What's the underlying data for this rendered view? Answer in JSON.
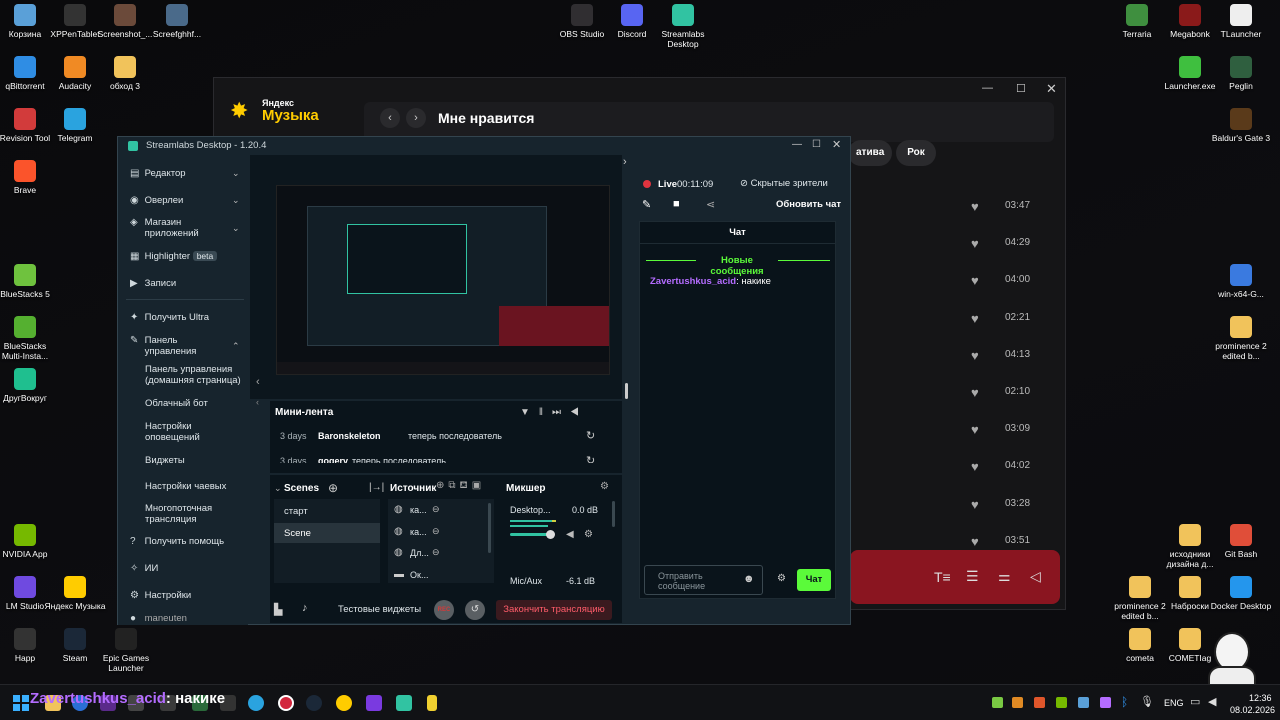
{
  "desktop": {
    "left_icons": [
      {
        "label": "Корзина",
        "icon": "recycle-bin-icon",
        "color": "#5aa0d8"
      },
      {
        "label": "XPPenTablet",
        "icon": "xppen-icon",
        "color": "#333333"
      },
      {
        "label": "Screenshot_...",
        "icon": "image-file-icon",
        "color": "#6b4a3a"
      },
      {
        "label": "Screefghhf...",
        "icon": "image-file-icon",
        "color": "#4a6a8a"
      },
      {
        "label": "qBittorrent",
        "icon": "qbittorrent-icon",
        "color": "#2f8de4"
      },
      {
        "label": "Audacity",
        "icon": "audacity-icon",
        "color": "#f08a24"
      },
      {
        "label": "обход 3",
        "icon": "folder-icon",
        "color": "#f1c35b"
      },
      {
        "label": "Revision Tool",
        "icon": "revision-tool-icon",
        "color": "#d23b3b"
      },
      {
        "label": "Telegram",
        "icon": "telegram-icon",
        "color": "#2aa3df"
      },
      {
        "label": "Brave",
        "icon": "brave-icon",
        "color": "#fb542b"
      },
      {
        "label": "BlueStacks 5",
        "icon": "bluestacks-icon",
        "color": "#6fc23e"
      },
      {
        "label": "BlueStacks Multi-Insta...",
        "icon": "bluestacks-multi-icon",
        "color": "#55b030"
      },
      {
        "label": "ДругВокруг",
        "icon": "drugvokrug-icon",
        "color": "#1fbf8f"
      },
      {
        "label": "NVIDIA App",
        "icon": "nvidia-icon",
        "color": "#76b900"
      },
      {
        "label": "LM Studio",
        "icon": "lm-studio-icon",
        "color": "#6f4ae0"
      },
      {
        "label": "Яндекс Музыка",
        "icon": "yandex-music-icon",
        "color": "#ffcc00"
      },
      {
        "label": "Happ",
        "icon": "happ-icon",
        "color": "#333333"
      },
      {
        "label": "Steam",
        "icon": "steam-icon",
        "color": "#1b2838"
      },
      {
        "label": "Epic Games Launcher",
        "icon": "epic-games-icon",
        "color": "#222222"
      }
    ],
    "top_center_icons": [
      {
        "label": "OBS Studio",
        "icon": "obs-icon",
        "color": "#302e31"
      },
      {
        "label": "Discord",
        "icon": "discord-icon",
        "color": "#5865f2"
      },
      {
        "label": "Streamlabs Desktop",
        "icon": "streamlabs-icon",
        "color": "#31c3a2"
      }
    ],
    "right_icons": [
      {
        "label": "Terraria",
        "icon": "terraria-icon",
        "color": "#3f8f3f"
      },
      {
        "label": "Megabonk",
        "icon": "megabonk-icon",
        "color": "#8a1a1a"
      },
      {
        "label": "TLauncher",
        "icon": "file-icon",
        "color": "#eeeeee"
      },
      {
        "label": "Launcher.exe",
        "icon": "launcher-icon",
        "color": "#3fbf3f"
      },
      {
        "label": "Peglin",
        "icon": "peglin-icon",
        "color": "#2f5f3f"
      },
      {
        "label": "Baldur's Gate 3",
        "icon": "baldurs-gate-icon",
        "color": "#5a3a1a"
      },
      {
        "label": "win-x64-G...",
        "icon": "app-icon",
        "color": "#3a7ae0"
      },
      {
        "label": "prominence 2 edited b...",
        "icon": "folder-icon",
        "color": "#f1c35b"
      },
      {
        "label": "исходники дизайна д...",
        "icon": "folder-icon",
        "color": "#f1c35b"
      },
      {
        "label": "Git Bash",
        "icon": "git-bash-icon",
        "color": "#e04e39"
      },
      {
        "label": "prominence 2 edited b...",
        "icon": "folder-icon",
        "color": "#f1c35b"
      },
      {
        "label": "Наброски",
        "icon": "folder-icon",
        "color": "#f1c35b"
      },
      {
        "label": "Docker Desktop",
        "icon": "docker-icon",
        "color": "#2496ed"
      },
      {
        "label": "cometa",
        "icon": "folder-icon",
        "color": "#f1c35b"
      },
      {
        "label": "COMETIag",
        "icon": "folder-icon",
        "color": "#f1c35b"
      }
    ]
  },
  "yandex_music": {
    "logo_top": "Яндекс",
    "logo_bottom": "Музыка",
    "page_title": "Мне нравится",
    "chips": [
      "ативa",
      "Рок"
    ],
    "durations": [
      "03:47",
      "04:29",
      "04:00",
      "02:21",
      "04:13",
      "02:10",
      "03:09",
      "04:02",
      "03:28",
      "03:51"
    ],
    "accent": "#ffcc00",
    "player_color": "#8a1520"
  },
  "streamlabs": {
    "title": "Streamlabs Desktop - 1.20.4",
    "sidebar": {
      "editor": "Редактор",
      "overlays": "Оверлеи",
      "app_store": "Магазин приложений",
      "highlighter": "Highlighter",
      "beta": "beta",
      "recordings": "Записи",
      "get_ultra": "Получить Ultra",
      "dashboard": "Панель управления",
      "dashboard_home": "Панель управления (домашняя страница)",
      "cloudbot": "Облачный бот",
      "alert_settings": "Настройки оповещений",
      "widgets": "Виджеты",
      "tip_settings": "Настройки чаевых",
      "multistream": "Многопоточная трансляция",
      "get_help": "Получить помощь",
      "ai": "ИИ",
      "settings": "Настройки",
      "account": "maneuten"
    },
    "minifeed": {
      "title": "Мини-лента",
      "rows": [
        {
          "time": "3 days",
          "user": "Baronskeleton",
          "text": "теперь последователь"
        },
        {
          "time": "3 days",
          "user": "qogery",
          "text": "теперь последователь"
        }
      ]
    },
    "scenes": {
      "title": "Scenes",
      "items": [
        "старт",
        "Scene"
      ]
    },
    "sources": {
      "title": "Источник",
      "items": [
        "ка...",
        "ка...",
        "Дл...",
        "Ок..."
      ]
    },
    "mixer": {
      "title": "Микшер",
      "channels": [
        {
          "name": "Desktop...",
          "db": "0.0 dB"
        },
        {
          "name": "Mic/Aux",
          "db": "-6.1 dB"
        }
      ]
    },
    "footer": {
      "test_widgets": "Тестовые виджеты",
      "rec": "REC",
      "end_stream": "Закончить трансляцию"
    },
    "live": {
      "status": "Live",
      "timer": "00:11:09",
      "hidden_viewers": "Скрытые зрители",
      "refresh_chat": "Обновить чат"
    },
    "chat": {
      "title": "Чат",
      "new_messages": "Новые сообщения",
      "messages": [
        {
          "user": "Zavertushkus_acid",
          "text": "накике"
        }
      ],
      "placeholder": "Отправить сообщение",
      "send": "Чат"
    },
    "accent": "#31c3a2",
    "send_color": "#5bfa3a",
    "username_color": "#b46cff"
  },
  "taskbar": {
    "overlay_user": "Zavertushkus_acid",
    "overlay_text": "накике",
    "lang": "ENG",
    "time": "12:36",
    "date": "08.02.2026"
  }
}
